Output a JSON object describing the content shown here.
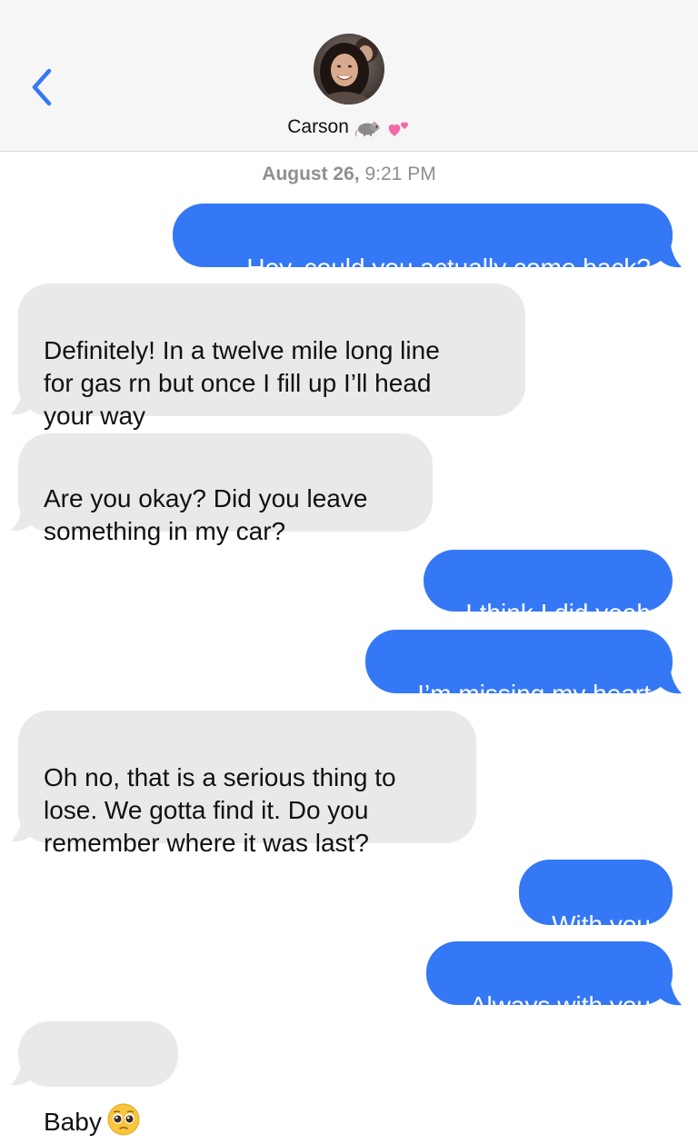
{
  "header": {
    "contact_name": "Carson",
    "contact_emojis": [
      "rat-emoji",
      "two-hearts-emoji"
    ],
    "back_icon": "chevron-left-icon"
  },
  "timestamp": {
    "date": "August 26,",
    "time": "9:21 PM"
  },
  "messages": [
    {
      "from": "me",
      "text": "Hey, could you actually come back?"
    },
    {
      "from": "them",
      "text": "Definitely! In a twelve mile long line\nfor gas rn but once I fill up I’ll head\nyour way"
    },
    {
      "from": "them",
      "text": "Are you okay? Did you leave\nsomething in my car?"
    },
    {
      "from": "me",
      "text": "I think I did yeah"
    },
    {
      "from": "me",
      "text": "I’m missing my heart"
    },
    {
      "from": "them",
      "text": "Oh no, that is a serious thing to\nlose. We gotta find it. Do you\nremember where it was last?"
    },
    {
      "from": "me",
      "text": "With you"
    },
    {
      "from": "me",
      "text": "Always with you"
    },
    {
      "from": "them",
      "text": "Baby",
      "emoji": "pleading-face-emoji"
    }
  ],
  "colors": {
    "sent_bubble": "#3478f6",
    "received_bubble": "#e9e9eb",
    "header_bg": "#f6f6f6",
    "accent": "#3478f6",
    "timestamp": "#8e8e93"
  }
}
